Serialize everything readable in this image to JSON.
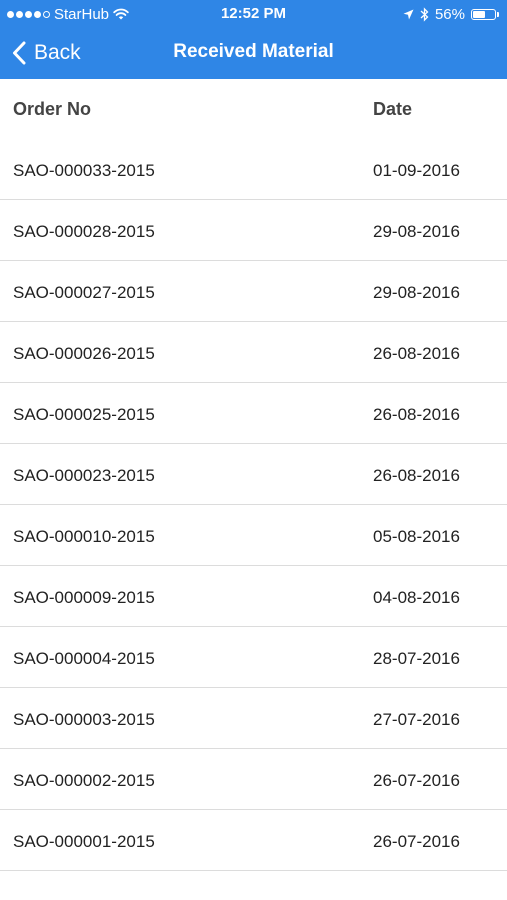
{
  "status_bar": {
    "carrier": "StarHub",
    "time": "12:52 PM",
    "battery_percent_text": "56%",
    "battery_level": 0.56
  },
  "nav": {
    "back_label": "Back",
    "title": "Received Material"
  },
  "table": {
    "headers": {
      "order_no": "Order No",
      "date": "Date"
    },
    "rows": [
      {
        "order_no": "SAO-000033-2015",
        "date": "01-09-2016"
      },
      {
        "order_no": "SAO-000028-2015",
        "date": "29-08-2016"
      },
      {
        "order_no": "SAO-000027-2015",
        "date": "29-08-2016"
      },
      {
        "order_no": "SAO-000026-2015",
        "date": "26-08-2016"
      },
      {
        "order_no": "SAO-000025-2015",
        "date": "26-08-2016"
      },
      {
        "order_no": "SAO-000023-2015",
        "date": "26-08-2016"
      },
      {
        "order_no": "SAO-000010-2015",
        "date": "05-08-2016"
      },
      {
        "order_no": "SAO-000009-2015",
        "date": "04-08-2016"
      },
      {
        "order_no": "SAO-000004-2015",
        "date": "28-07-2016"
      },
      {
        "order_no": "SAO-000003-2015",
        "date": "27-07-2016"
      },
      {
        "order_no": "SAO-000002-2015",
        "date": "26-07-2016"
      },
      {
        "order_no": "SAO-000001-2015",
        "date": "26-07-2016"
      }
    ]
  },
  "colors": {
    "header_blue": "#2f86e6",
    "row_divider": "#dcdcdc"
  }
}
